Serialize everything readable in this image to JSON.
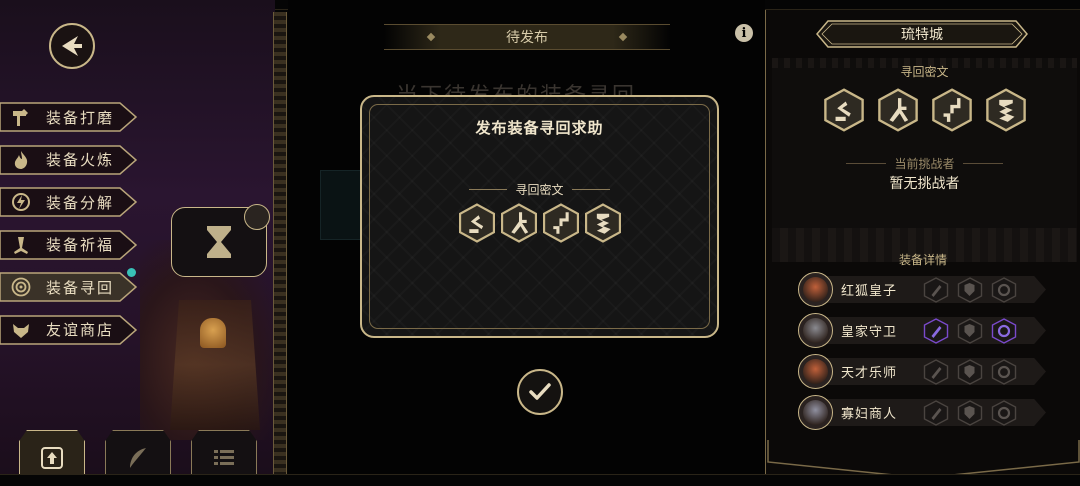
{
  "left_menu": {
    "items": [
      {
        "label": "装备打磨",
        "icon": "hammer-icon"
      },
      {
        "label": "装备火炼",
        "icon": "flame-icon"
      },
      {
        "label": "装备分解",
        "icon": "decompose-icon"
      },
      {
        "label": "装备祈福",
        "icon": "pray-icon"
      },
      {
        "label": "装备寻回",
        "icon": "target-icon",
        "active": true
      },
      {
        "label": "友谊商店",
        "icon": "fox-shop-icon"
      }
    ]
  },
  "center": {
    "header_title": "待发布",
    "behind_text": "当下待发布的装备寻回",
    "modal": {
      "title": "发布装备寻回求助",
      "cipher_label": "寻回密文",
      "runes": [
        "rune-1-icon",
        "rune-2-icon",
        "rune-3-icon",
        "rune-4-icon"
      ]
    }
  },
  "right_panel": {
    "city_name": "琉特城",
    "cipher_label": "寻回密文",
    "challenger_label": "当前挑战者",
    "challenger_value": "暂无挑战者",
    "equipment_label": "装备详情",
    "equipment": [
      {
        "name": "红狐皇子",
        "avatar_color": "#c0603a",
        "slots": [
          "dim",
          "dim",
          "dim"
        ]
      },
      {
        "name": "皇家守卫",
        "avatar_color": "#8a8a90",
        "slots": [
          "purple",
          "dim",
          "purple"
        ]
      },
      {
        "name": "天才乐师",
        "avatar_color": "#c0603a",
        "slots": [
          "dim",
          "dim",
          "dim"
        ]
      },
      {
        "name": "寡妇商人",
        "avatar_color": "#9090a0",
        "slots": [
          "dim",
          "dim",
          "dim"
        ]
      }
    ]
  },
  "colors": {
    "gold": "#c9b789",
    "purple_accent": "#7a4acc",
    "notification": "#38c0b8"
  }
}
